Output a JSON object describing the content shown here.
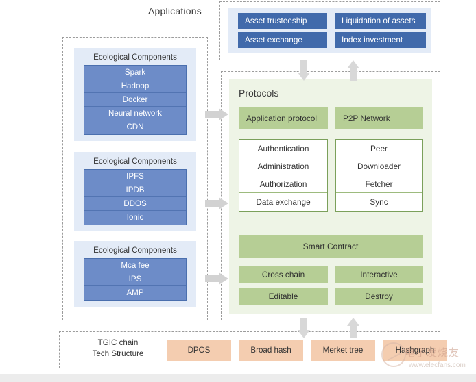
{
  "diagram": {
    "applications_title": "Applications",
    "protocols_title": "Protocols"
  },
  "applications": {
    "boxes": [
      {
        "label": "Asset trusteeship"
      },
      {
        "label": "Liquidation of assets"
      },
      {
        "label": "Asset exchange"
      },
      {
        "label": "Index investment"
      }
    ]
  },
  "ecological": {
    "groups": [
      {
        "heading": "Ecological Components",
        "items": [
          "Spark",
          "Hadoop",
          "Docker",
          "Neural network",
          "CDN"
        ]
      },
      {
        "heading": "Ecological Components",
        "items": [
          "IPFS",
          "IPDB",
          "DDOS",
          "Ionic"
        ]
      },
      {
        "heading": "Ecological Components",
        "items": [
          "Mca fee",
          "IPS",
          "AMP"
        ]
      }
    ]
  },
  "protocols": {
    "columns": [
      {
        "header": "Application protocol",
        "items": [
          "Authentication",
          "Administration",
          "Authorization",
          "Data exchange"
        ]
      },
      {
        "header": "P2P Network",
        "items": [
          "Peer",
          "Downloader",
          "Fetcher",
          "Sync"
        ]
      }
    ],
    "smart_contract": "Smart Contract",
    "smart_contract_boxes": [
      "Cross chain",
      "Interactive",
      "Editable",
      "Destroy"
    ]
  },
  "tgic": {
    "label_line1": "TGIC chain",
    "label_line2": "Tech Structure",
    "boxes": [
      "DPOS",
      "Broad hash",
      "Merket tree",
      "Hashgraph"
    ]
  },
  "watermark": {
    "text_cn": "电子发烧友",
    "url": "www.elecfans.com"
  },
  "colors": {
    "component_blue": "#6d8cc8",
    "application_blue": "#416aab",
    "panel_light_blue": "#e3ebf7",
    "protocol_green": "#b6ce95",
    "panel_light_green": "#eef4e6",
    "tgic_orange": "#f4cdb0",
    "arrow_gray": "#d8d8d8",
    "dashed_border": "#9c9c9c"
  }
}
